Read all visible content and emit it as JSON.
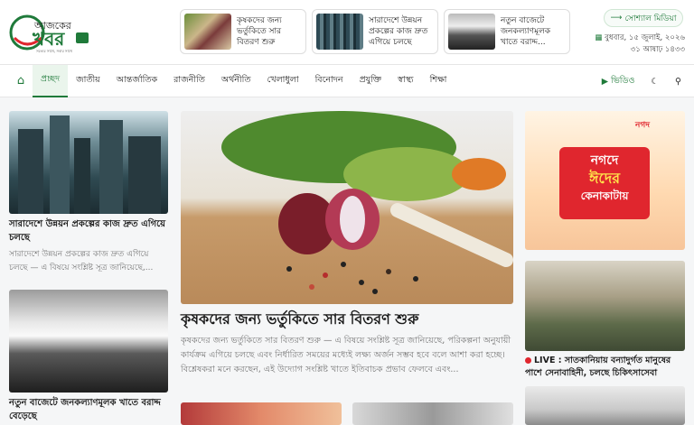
{
  "brand": {
    "name_line1": "আজকের",
    "name_line2": "খবর",
    "tagline": "সত্যের সাথে, সবার সাথে"
  },
  "headlines": [
    {
      "title": "কৃষকদের জন্য ভর্তুকিতে সার বিতরণ শুরু"
    },
    {
      "title": "সারাদেশে উন্নয়ন প্রকল্পের কাজ দ্রুত এগিয়ে চলছে"
    },
    {
      "title": "নতুন বাজেটে জনকল্যাণমূলক খাতে বরাদ্দ..."
    }
  ],
  "social": {
    "label": "সোশ্যাল মিডিয়া"
  },
  "date": {
    "line1": "বুধবার, ১৫ জুলাই, ২০২৬",
    "line2": "৩১ আষাঢ় ১৪৩৩"
  },
  "nav": {
    "items": [
      "প্রচ্ছদ",
      "জাতীয়",
      "আন্তর্জাতিক",
      "রাজনীতি",
      "অর্থনীতি",
      "খেলাধুলা",
      "বিনোদন",
      "প্রযুক্তি",
      "স্বাস্থ্য",
      "শিক্ষা"
    ],
    "video": "ভিডিও"
  },
  "left": [
    {
      "title": "সারাদেশে উন্নয়ন প্রকল্পের কাজ দ্রুত এগিয়ে চলছে",
      "desc": "সারাদেশে উন্নয়ন প্রকল্পের কাজ দ্রুত এগিয়ে চলছে — এ বিষয়ে সংশ্লিষ্ট সূত্র জানিয়েছে,..."
    },
    {
      "title": "নতুন বাজেটে জনকল্যাণমূলক খাতে বরাদ্দ বেড়েছে"
    }
  ],
  "lead": {
    "title": "কৃষকদের জন্য ভর্তুকিতে সার বিতরণ শুরু",
    "desc": "কৃষকদের জন্য ভর্তুকিতে সার বিতরণ শুরু — এ বিষয়ে সংশ্লিষ্ট সূত্র জানিয়েছে, পরিকল্পনা অনুযায়ী কার্যক্রম এগিয়ে চলছে এবং নির্ধারিত সময়ের মধ্যেই লক্ষ্য অর্জন সম্ভব হবে বলে আশা করা হচ্ছে। বিশ্লেষকরা মনে করছেন, এই উদ্যোগ সংশ্লিষ্ট খাতে ইতিবাচক প্রভাব ফেলবে এবং..."
  },
  "ad": {
    "brand": "নগদ",
    "line1": "নগদে",
    "line2": "ঈদের",
    "line3": "কেনাকাটায়"
  },
  "right": {
    "live_label": "LIVE :",
    "title": "সাতকানিয়ায় বন্যাদুর্গত মানুষের পাশে সেনাবাহিনী, চলছে চিকিৎসাসেবা"
  },
  "colors": {
    "brand_green": "#1f7a3a",
    "accent_red": "#e0262e"
  }
}
